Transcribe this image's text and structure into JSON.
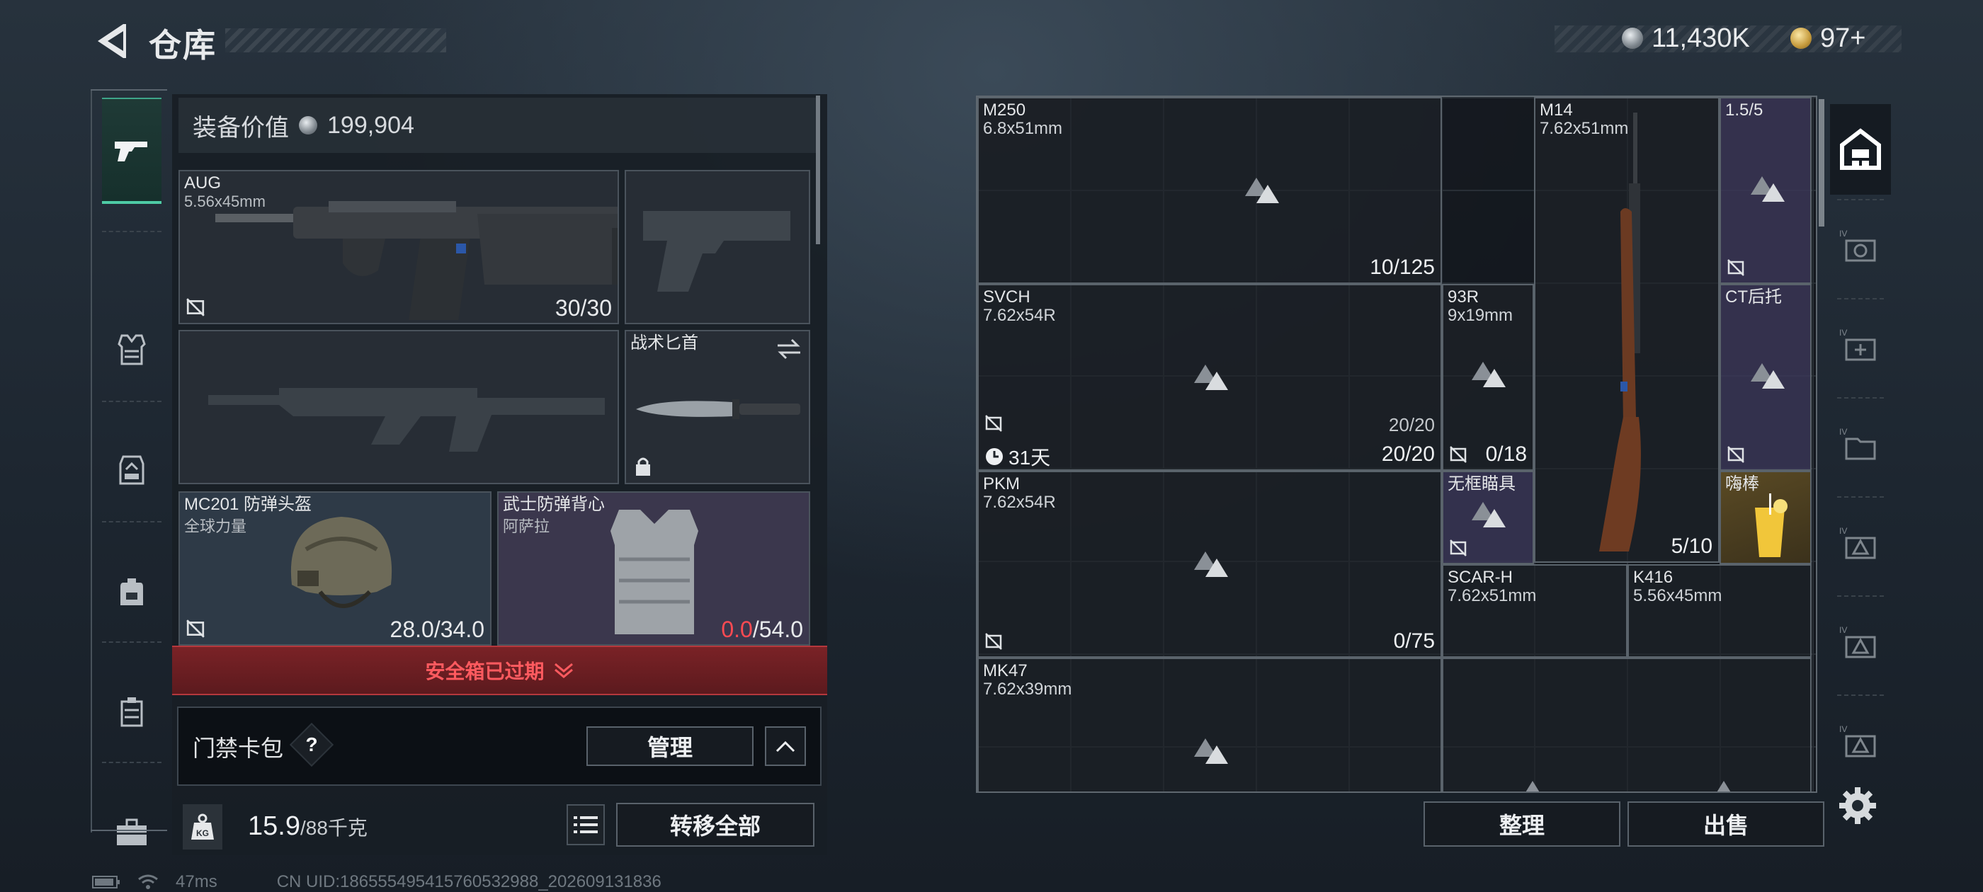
{
  "header": {
    "title": "仓库",
    "currency_silver": "11,430K",
    "currency_gold": "97+"
  },
  "left_rail": {
    "items": [
      {
        "icon": "pistol-icon",
        "active": true
      },
      {
        "icon": "vest-icon"
      },
      {
        "icon": "rig-icon"
      },
      {
        "icon": "backpack-icon"
      },
      {
        "icon": "case-icon"
      },
      {
        "icon": "toolbox-icon"
      }
    ]
  },
  "loadout": {
    "value_label": "装备价值",
    "value": "199,904",
    "primary": {
      "name": "AUG",
      "caliber": "5.56x45mm",
      "ammo": "30/30"
    },
    "knife": {
      "name": "战术匕首"
    },
    "helmet": {
      "name": "MC201 防弹头盔",
      "brand": "全球力量",
      "durability": "28.0/34.0"
    },
    "armor": {
      "name": "武士防弹背心",
      "brand": "阿萨拉",
      "durability_current": "0.0",
      "durability_max": "/54.0"
    },
    "safebox_expired": "安全箱已过期",
    "card_pack": "门禁卡包",
    "help_q": "?",
    "manage": "管理",
    "weight": "15.9",
    "weight_max": "/88千克",
    "transfer_all": "转移全部"
  },
  "status": {
    "ping": "47ms",
    "uid": "CN UID:186555495415760532988_202609131836"
  },
  "stash": {
    "items": [
      {
        "name": "M250",
        "caliber": "6.8x51mm",
        "count": "10/125"
      },
      {
        "name": "M14",
        "caliber": "7.62x51mm",
        "count": "5/10"
      },
      {
        "name": "1.5/5"
      },
      {
        "name": "SVCH",
        "caliber": "7.62x54R",
        "count": "20/20",
        "count_secondary": "20/20",
        "timer": "31天"
      },
      {
        "name": "93R",
        "caliber": "9x19mm",
        "count": "0/18"
      },
      {
        "name": "CT后托"
      },
      {
        "name": "PKM",
        "caliber": "7.62x54R",
        "count": "0/75"
      },
      {
        "name": "无框瞄具"
      },
      {
        "name": "嗨棒"
      },
      {
        "name": "SCAR-H",
        "caliber": "7.62x51mm"
      },
      {
        "name": "K416",
        "caliber": "5.56x45mm"
      },
      {
        "name": "MK47",
        "caliber": "7.62x39mm"
      }
    ],
    "sort": "整理",
    "sell": "出售"
  },
  "colors": {
    "accent": "#4ecba5",
    "danger": "#ff4a52",
    "purple_rarity": "#3a3656",
    "gold_rarity": "#5a4a24"
  }
}
